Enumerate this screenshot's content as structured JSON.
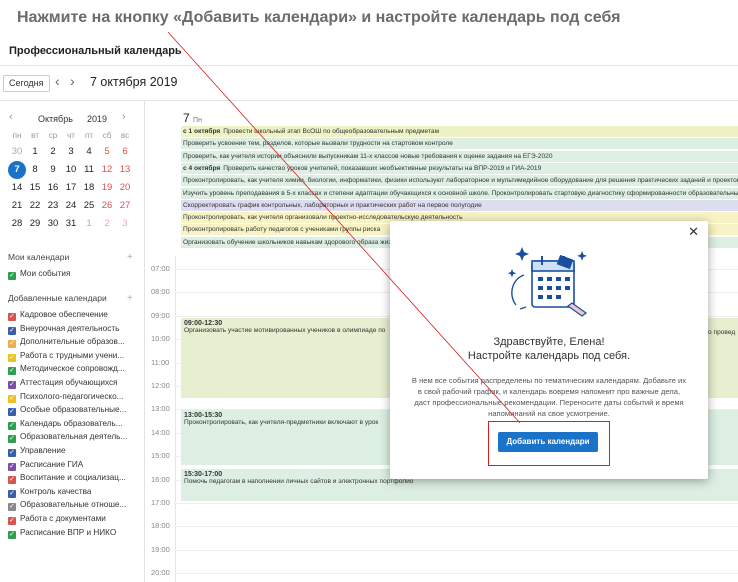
{
  "instruction": "Нажмите на кнопку «Добавить календари» и настройте календарь под себя",
  "app": {
    "title": "Профессиональный календарь"
  },
  "toolbar": {
    "today_label": "Сегодня",
    "prev": "‹",
    "next": "›",
    "current_date": "7 октября 2019"
  },
  "mini_calendar": {
    "month": "Октябрь",
    "year": "2019",
    "prev": "‹",
    "next": "›",
    "weekdays": [
      "пн",
      "вт",
      "ср",
      "чт",
      "пт",
      "сб",
      "вс"
    ],
    "weeks": [
      [
        "30",
        "1",
        "2",
        "3",
        "4",
        "5",
        "6"
      ],
      [
        "7",
        "8",
        "9",
        "10",
        "11",
        "12",
        "13"
      ],
      [
        "14",
        "15",
        "16",
        "17",
        "18",
        "19",
        "20"
      ],
      [
        "21",
        "22",
        "23",
        "24",
        "25",
        "26",
        "27"
      ],
      [
        "28",
        "29",
        "30",
        "31",
        "1",
        "2",
        "3"
      ]
    ]
  },
  "sidebar": {
    "my_calendars_header": "Мои календари",
    "my_calendars": [
      {
        "label": "Мои события",
        "color": "#2e9e4f"
      }
    ],
    "added_calendars_header": "Добавленные календари",
    "added_calendars": [
      {
        "label": "Кадровое обеспечение",
        "color": "#d9534f"
      },
      {
        "label": "Внеурочная деятельность",
        "color": "#3a5fa8"
      },
      {
        "label": "Дополнительные образов...",
        "color": "#f0ad4e"
      },
      {
        "label": "Работа с трудными учени...",
        "color": "#e8c522"
      },
      {
        "label": "Методическое сопровожд...",
        "color": "#2e9e4f"
      },
      {
        "label": "Аттестация обучающихся",
        "color": "#7a4fa8"
      },
      {
        "label": "Психолого-педагогическо...",
        "color": "#f0c020"
      },
      {
        "label": "Особые образовательные...",
        "color": "#3a5fa8"
      },
      {
        "label": "Календарь образователь...",
        "color": "#2e9e4f"
      },
      {
        "label": "Образовательная деятель...",
        "color": "#2e9e4f"
      },
      {
        "label": "Управление",
        "color": "#3a5fa8"
      },
      {
        "label": "Расписание ГИА",
        "color": "#7a4fa8"
      },
      {
        "label": "Воспитание и социализац...",
        "color": "#d9534f"
      },
      {
        "label": "Контроль качества",
        "color": "#3a5fa8"
      },
      {
        "label": "Образовательные отноше...",
        "color": "#888888"
      },
      {
        "label": "Работа с документами",
        "color": "#d9534f"
      },
      {
        "label": "Расписание ВПР и НИКО",
        "color": "#2e9e4f"
      }
    ]
  },
  "day": {
    "num": "7",
    "weekday": "Пн"
  },
  "allday_events": [
    {
      "date": "с 1 октября",
      "text": "Провести школьный этап ВсОШ по общеобразовательным предметам",
      "color": "#eef2c4"
    },
    {
      "date": "",
      "text": "Проверить усвоение тем, разделов, которые вызвали трудности на стартовом контроле",
      "color": "#dcefe2"
    },
    {
      "date": "",
      "text": "Проверить, как учителя истории объяснили выпускникам 11-х классов новые требования к оценке задания на ЕГЭ-2020",
      "color": "#dcefe2"
    },
    {
      "date": "с 4 октября",
      "text": "Проверить качество уроков учителей, показавших необъективные результаты на ВПР-2019 и ГИА-2019",
      "color": "#dcefe2"
    },
    {
      "date": "",
      "text": "Проконтролировать, как учителя химии, биологии, информатики, физики используют лабораторное и мультимедийное оборудование для решения практических заданий и проектов",
      "color": "#dcefe2"
    },
    {
      "date": "",
      "text": "Изучить уровень преподавания в 5-х классах и степени адаптации обучающихся к основной школе. Проконтролировать стартовую диагностику сформированности образовательных результатов",
      "color": "#dcefe2"
    },
    {
      "date": "",
      "text": "Скорректировать график контрольных, лабораторных и практических работ на первое полугодие",
      "color": "#dedcef"
    },
    {
      "date": "",
      "text": "Проконтролировать, как учителя организовали проектно-исследовательскую деятельность",
      "color": "#f7f3c4"
    },
    {
      "date": "",
      "text": "Проконтролировать работу педагогов с учениками группы риска",
      "color": "#f7f3c4"
    },
    {
      "date": "",
      "text": "Организовать обучение школьников навыкам здорового образа жизни",
      "color": "#dcefe2"
    }
  ],
  "time_labels": [
    "07:00",
    "08:00",
    "09:00",
    "10:00",
    "11:00",
    "12:00",
    "13:00",
    "14:00",
    "15:00",
    "16:00",
    "17:00",
    "18:00",
    "19:00",
    "20:00"
  ],
  "timed_events": [
    {
      "time": "09:00-12:30",
      "text": "Организовать участие мотивированных учеников в олимпиаде по",
      "tail": "о провед",
      "color": "#e6efcf"
    },
    {
      "time": "13:00-15:30",
      "text": "Проконтролировать, как учителя-предметники включают в урок",
      "color": "#dcefe2"
    },
    {
      "time": "15:30-17:00",
      "text": "Помочь педагогам в наполнении личных сайтов и электронных портфолио",
      "color": "#dcefe2"
    }
  ],
  "modal": {
    "close": "✕",
    "greeting": "Здравствуйте, Елена!",
    "subtitle": "Настройте календарь под себя.",
    "text": "В нем все события распределены по тематическим календарям. Добавьте их в свой рабочий график, и календарь вовремя напомнит про важные дела, даст профессиональные рекомендации. Переносите даты событий и время напоминаний на свое усмотрение.",
    "button": "Добавить календари"
  }
}
